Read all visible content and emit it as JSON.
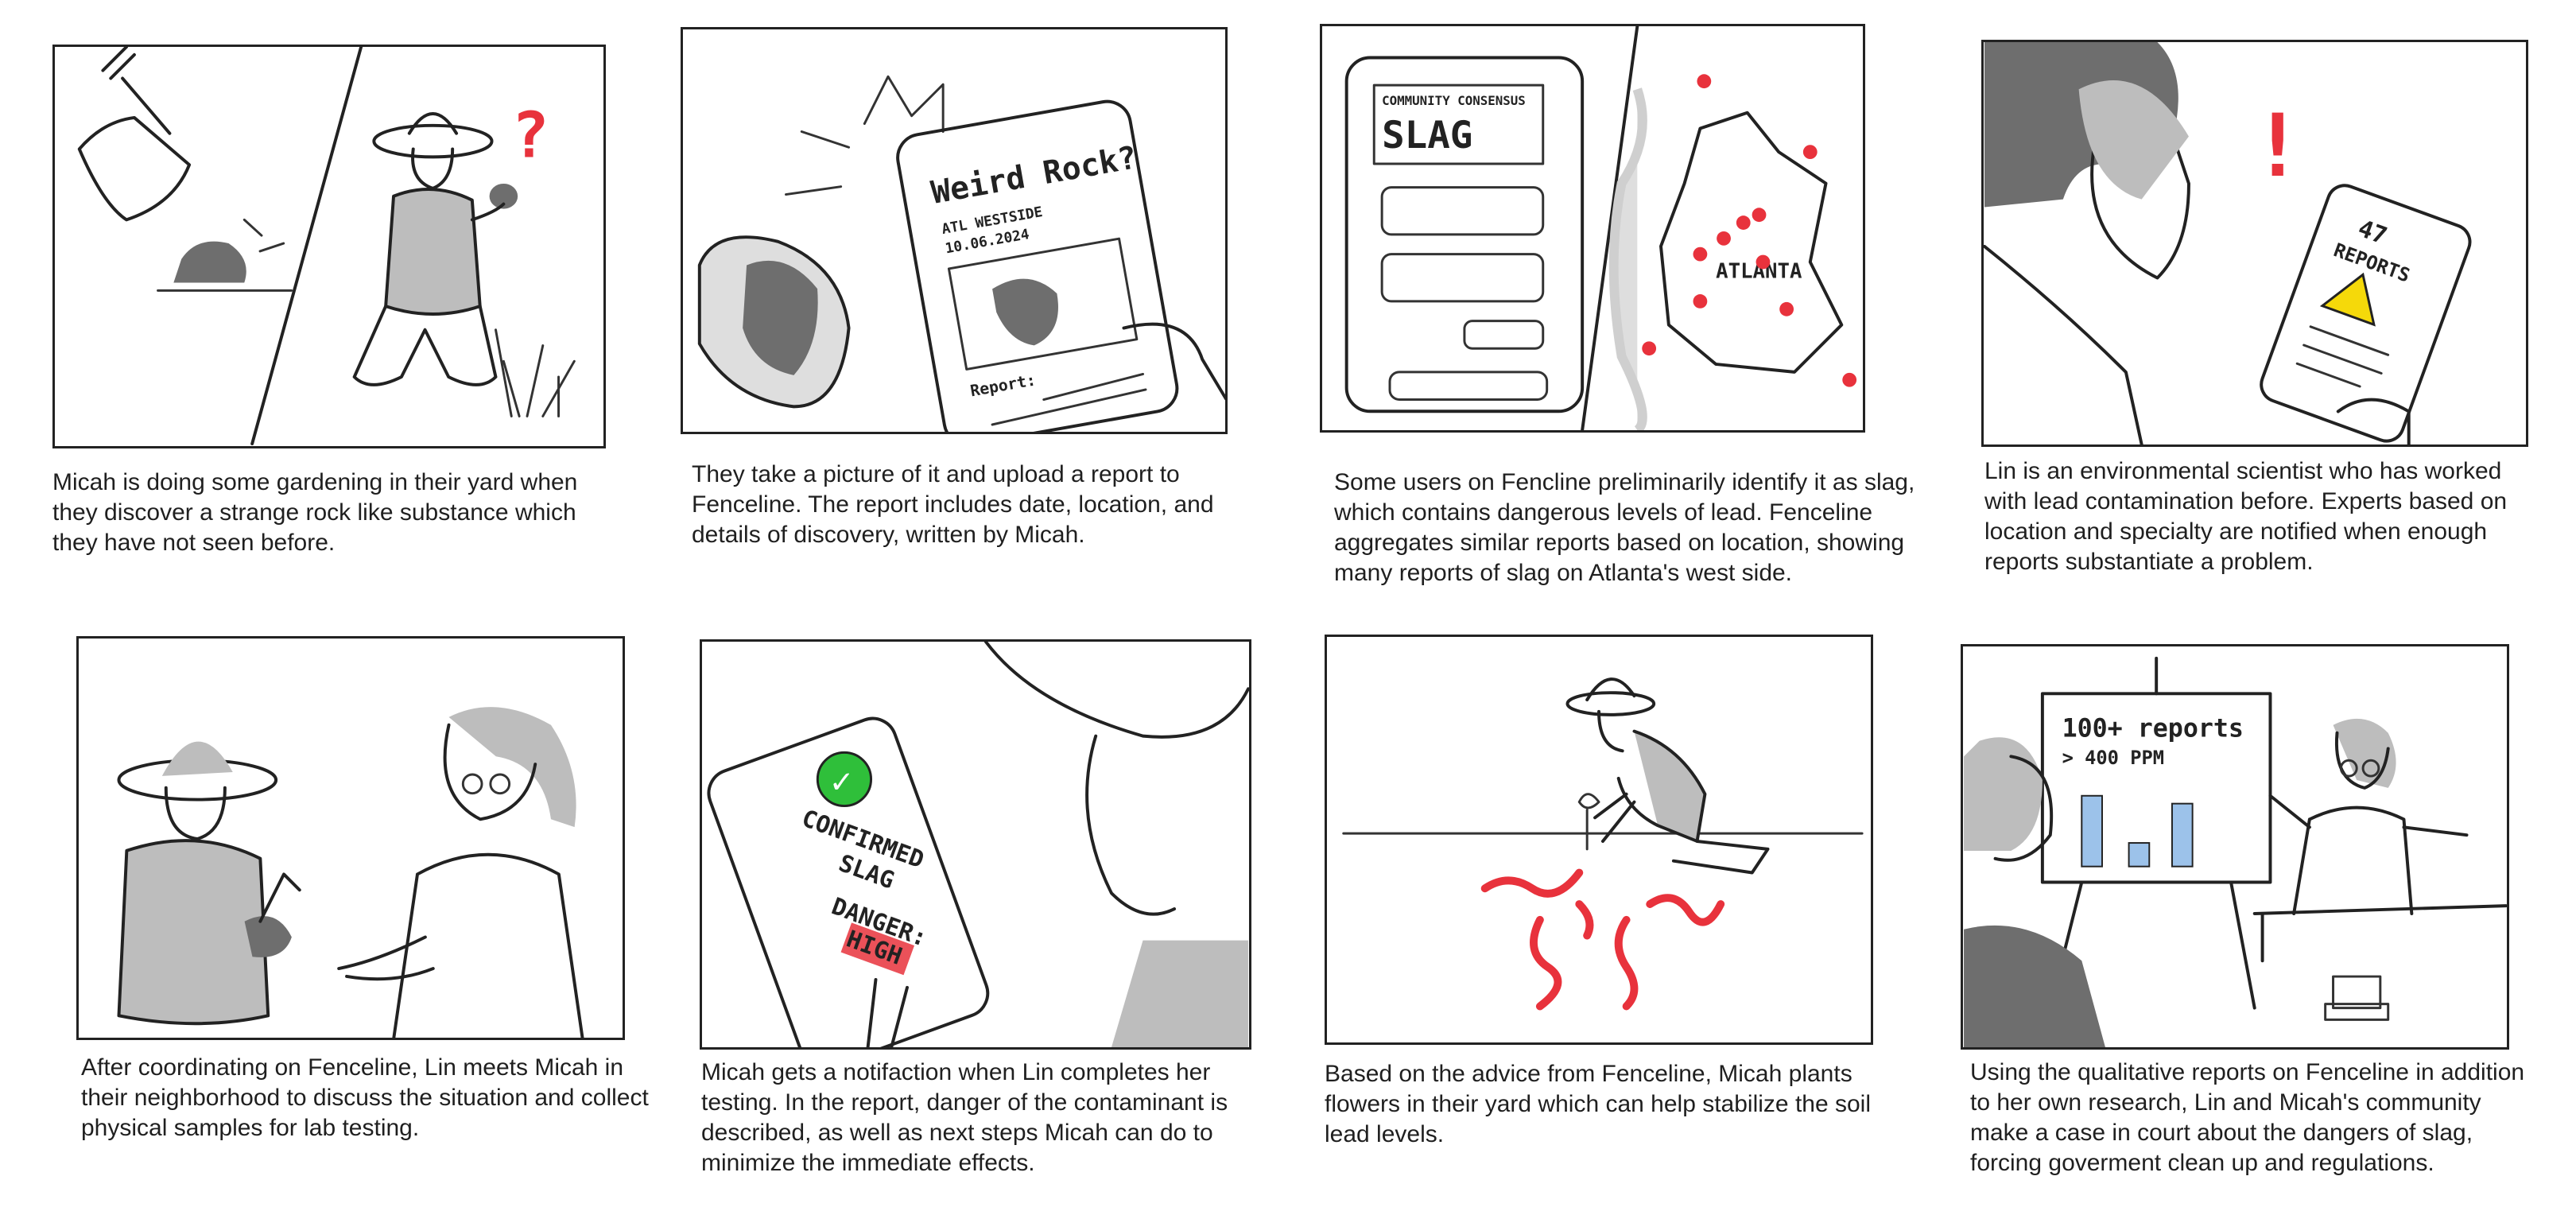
{
  "panels": [
    {
      "caption": "Micah is doing some gardening in their yard when they discover a strange rock like substance which they have not seen before.",
      "sketch_text": [
        "?"
      ]
    },
    {
      "caption": "They take a picture of it and upload a report to Fenceline. The report includes date, location, and details of discovery, written by Micah.",
      "sketch_text": [
        "Weird Rock?",
        "ATL WESTSIDE",
        "10.06.2024",
        "Report:"
      ]
    },
    {
      "caption": "Some users on Fencline preliminarily identify it as slag, which contains dangerous levels of lead. Fenceline aggregates similar reports based on location, showing many reports of slag on Atlanta's west side.",
      "sketch_text": [
        "COMMUNITY CONSENSUS",
        "SLAG",
        "ATLANTA"
      ]
    },
    {
      "caption": "Lin is an environmental scientist who has worked with lead contamination before. Experts based on location and specialty are notified when enough reports substantiate a problem.",
      "sketch_text": [
        "!",
        "47",
        "REPORTS",
        "⚠"
      ]
    },
    {
      "caption": "After coordinating on Fenceline, Lin meets Micah in their neighborhood to discuss the situation and collect physical samples for lab testing.",
      "sketch_text": []
    },
    {
      "caption": "Micah gets a notifaction when Lin completes her testing. In the report, danger of the contaminant is described, as well as next steps Micah can do to minimize the immediate effects.",
      "sketch_text": [
        "✓",
        "CONFIRMED",
        "SLAG",
        "DANGER:",
        "HIGH"
      ]
    },
    {
      "caption": "Based on the advice from Fenceline, Micah plants flowers in their yard which can help stabilize the soil lead levels.",
      "sketch_text": []
    },
    {
      "caption": "Using the qualitative reports on Fenceline in addition to her own research, Lin and Micah's community make a case in court about the dangers of slag, forcing goverment clean up and regulations.",
      "sketch_text": [
        "100+ reports",
        "> 400 PPM"
      ]
    }
  ],
  "colors": {
    "accent_red": "#e8323c",
    "check_green": "#2fbf3a",
    "warning_yellow": "#f5d90a",
    "chart_blue": "#9cc2ea"
  }
}
